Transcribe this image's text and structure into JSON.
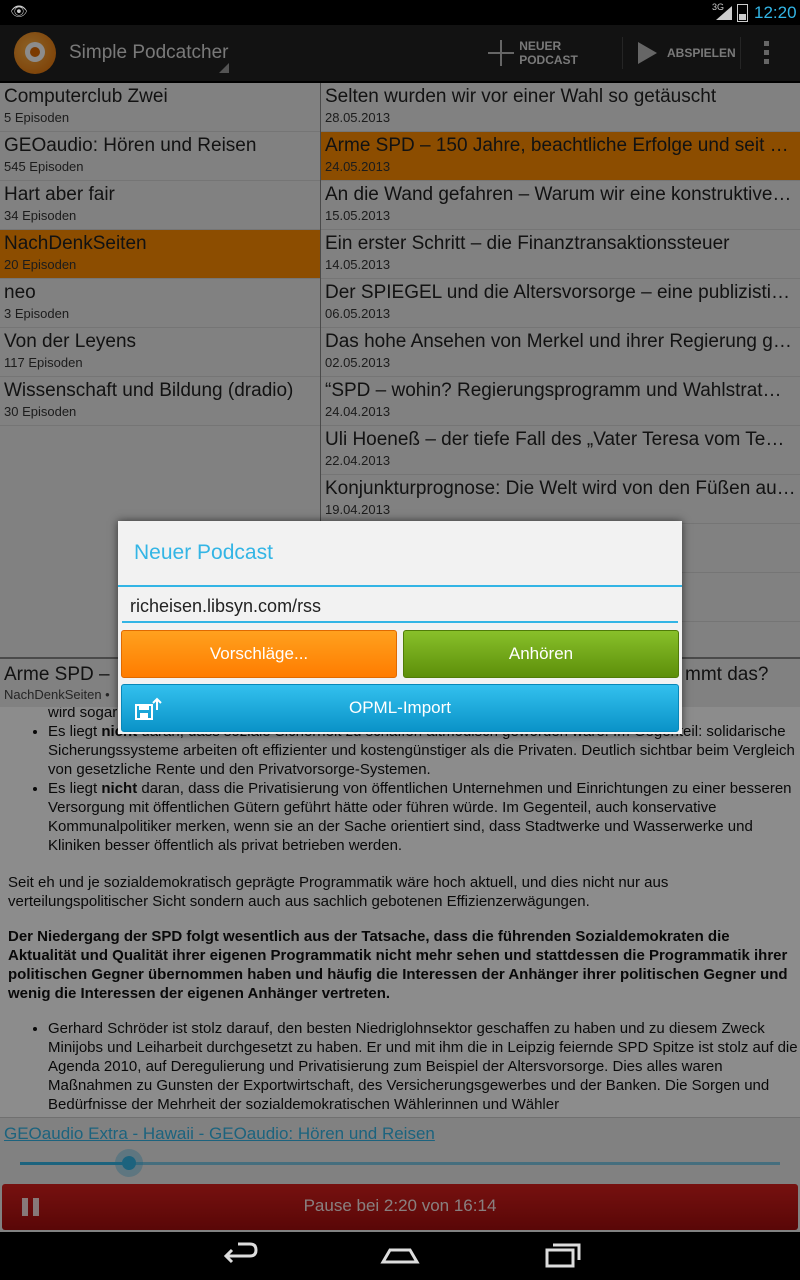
{
  "status_bar": {
    "network": "3G",
    "time": "12:20"
  },
  "action_bar": {
    "title": "Simple Podcatcher",
    "new_podcast_label": "NEUER PODCAST",
    "play_label": "ABSPIELEN"
  },
  "podcasts": [
    {
      "title": "Computerclub Zwei",
      "count": "5 Episoden",
      "selected": false
    },
    {
      "title": "GEOaudio: Hören und Reisen",
      "count": "545 Episoden",
      "selected": false
    },
    {
      "title": "Hart aber fair",
      "count": "34 Episoden",
      "selected": false
    },
    {
      "title": "NachDenkSeiten",
      "count": "20 Episoden",
      "selected": true
    },
    {
      "title": "neo",
      "count": "3 Episoden",
      "selected": false
    },
    {
      "title": "Von der Leyens",
      "count": "117 Episoden",
      "selected": false
    },
    {
      "title": "Wissenschaft und Bildung (dradio)",
      "count": "30 Episoden",
      "selected": false
    }
  ],
  "episodes": [
    {
      "title": "Selten wurden wir vor einer Wahl so getäuscht",
      "date": "28.05.2013",
      "selected": false
    },
    {
      "title": "Arme SPD – 150 Jahre, beachtliche Erfolge und seit …",
      "date": "24.05.2013",
      "selected": true
    },
    {
      "title": "An die Wand gefahren – Warum wir eine konstruktive…",
      "date": "15.05.2013",
      "selected": false
    },
    {
      "title": "Ein erster Schritt – die Finanztransaktionssteuer",
      "date": "14.05.2013",
      "selected": false
    },
    {
      "title": "Der SPIEGEL und die Altersvorsorge – eine publizisti…",
      "date": "06.05.2013",
      "selected": false
    },
    {
      "title": "Das hohe Ansehen von Merkel und ihrer Regierung g…",
      "date": "02.05.2013",
      "selected": false
    },
    {
      "title": "“SPD – wohin? Regierungsprogramm und Wahlstrat…",
      "date": "24.04.2013",
      "selected": false
    },
    {
      "title": "Uli Hoeneß – der tiefe Fall des „Vater Teresa vom Te…",
      "date": "22.04.2013",
      "selected": false
    },
    {
      "title": "Konjunkturprognose: Die Welt wird von den Füßen au…",
      "date": "19.04.2013",
      "selected": false
    },
    {
      "title": "…die Grenze…",
      "date": "",
      "selected": false
    },
    {
      "title": "…einungsmac…",
      "date": "",
      "selected": false
    },
    {
      "title": "…uelle, die es …",
      "date": "",
      "selected": false
    }
  ],
  "episode_header": {
    "title": "Arme SPD –",
    "podcast": "NachDenkSeiten •",
    "right_text": "mmt das?"
  },
  "content": {
    "fragment_top": "wird sogar",
    "bullets_1": [
      {
        "lead": "Es liegt ",
        "bold": "nicht",
        "rest": " daran, dass soziale Sicherheit zu schaffen altmodisch geworden wäre. Im Gegenteil: solidarische Sicherungssysteme arbeiten oft effizienter und kostengünstiger als die Privaten. Deutlich sichtbar beim Vergleich von gesetzliche Rente und den Privatvorsorge-Systemen."
      },
      {
        "lead": "Es liegt ",
        "bold": "nicht",
        "rest": " daran, dass die Privatisierung von öffentlichen Unternehmen und Einrichtungen zu einer besseren Versorgung mit öffentlichen Gütern geführt hätte oder führen würde. Im Gegenteil, auch konservative Kommunalpolitiker merken, wenn sie an der Sache orientiert sind, dass Stadtwerke und Wasserwerke und Kliniken besser öffentlich als privat betrieben werden."
      }
    ],
    "paragraph_1": "Seit eh und je sozialdemokratisch geprägte Programmatik wäre hoch aktuell, und dies nicht nur aus verteilungspolitischer Sicht sondern auch aus sachlich gebotenen Effizienzerwägungen.",
    "paragraph_bold": "Der Niedergang der SPD folgt wesentlich aus der Tatsache, dass die führenden Sozialdemokraten die Aktualität und Qualität ihrer eigenen Programmatik nicht mehr sehen und stattdessen die Programmatik ihrer politischen Gegner übernommen haben und häufig die Interessen der Anhänger ihrer politischen Gegner und wenig die Interessen der eigenen Anhänger vertreten.",
    "bullet_2": "Gerhard Schröder ist stolz darauf, den besten Niedriglohnsektor geschaffen zu haben und zu diesem Zweck Minijobs und Leiharbeit durchgesetzt zu haben. Er und mit ihm die in Leipzig feiernde SPD Spitze ist stolz auf die Agenda 2010, auf Deregulierung und Privatisierung zum Beispiel der Altersvorsorge. Dies alles waren Maßnahmen zu Gunsten der Exportwirtschaft, des Versicherungsgewerbes und der Banken. Die Sorgen und Bedürfnisse der Mehrheit der sozialdemokratischen Wählerinnen und Wähler"
  },
  "dialog": {
    "title": "Neuer Podcast",
    "url_value": "richeisen.libsyn.com/rss",
    "suggestions_label": "Vorschläge...",
    "listen_label": "Anhören",
    "opml_label": "OPML-Import"
  },
  "player": {
    "now_playing": "GEOaudio Extra - Hawaii - GEOaudio: Hören und Reisen",
    "progress_fraction": 0.143,
    "status": "Pause bei 2:20 von 16:14"
  },
  "colors": {
    "accent": "#33b5e5",
    "selection": "#ff8c00",
    "suggest_button": "#ff8c00",
    "listen_button": "#6fa516",
    "opml_button": "#1aa5d8",
    "pause_bar": "#c01515"
  }
}
